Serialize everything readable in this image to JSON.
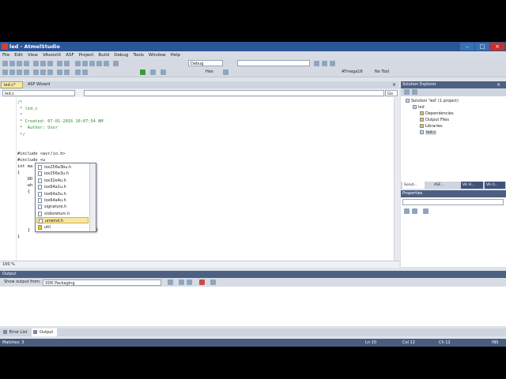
{
  "window": {
    "title": "led - AtmelStudio"
  },
  "menu": [
    "File",
    "Edit",
    "View",
    "VAssistX",
    "ASF",
    "Project",
    "Build",
    "Debug",
    "Tools",
    "Window",
    "Help"
  ],
  "toolbar": {
    "config_value": "Debug",
    "hex_label": "Hex",
    "device_label": "ATmega16",
    "tool_label": "No Tool"
  },
  "tabs": [
    {
      "label": "led.c*"
    },
    {
      "label": "ASF Wizard"
    }
  ],
  "navbar": {
    "file": "led.c",
    "go_label": "Go"
  },
  "code": [
    {
      "text": "/*",
      "kind": "comment"
    },
    {
      "text": " * led.c",
      "kind": "comment"
    },
    {
      "text": " *",
      "kind": "comment"
    },
    {
      "text": " * Created: 07-01-2016 10:07:54 AM",
      "kind": "comment"
    },
    {
      "text": " *  Author: User",
      "kind": "comment"
    },
    {
      "text": " */",
      "kind": "comment"
    },
    {
      "text": "",
      "kind": "plain"
    },
    {
      "text": "",
      "kind": "plain"
    },
    {
      "text": "#include <avr/io.h>",
      "kind": "plain"
    },
    {
      "text": "#include <u",
      "kind": "plain"
    },
    {
      "text": "int ma",
      "kind": "plain"
    },
    {
      "text": "{",
      "kind": "plain"
    },
    {
      "text": "    DD",
      "kind": "plain"
    },
    {
      "text": "    wh",
      "kind": "plain"
    },
    {
      "text": "    {",
      "kind": "plain"
    },
    {
      "text": "                  D's OFF",
      "kind": "comment"
    },
    {
      "text": "",
      "kind": "plain"
    },
    {
      "text": "",
      "kind": "plain"
    },
    {
      "text": "                  D's ON",
      "kind": "comment"
    },
    {
      "text": "",
      "kind": "plain"
    },
    {
      "text": "    }",
      "kind": "plain"
    },
    {
      "text": "}",
      "kind": "plain"
    }
  ],
  "autocomplete": {
    "items": [
      {
        "label": "iox256a3bu.h",
        "kind": "file"
      },
      {
        "label": "iox256a3u.h",
        "kind": "file"
      },
      {
        "label": "iox32e4u.h",
        "kind": "file"
      },
      {
        "label": "iox64a1u.h",
        "kind": "file"
      },
      {
        "label": "iox64a3u.h",
        "kind": "file"
      },
      {
        "label": "iox64a4u.h",
        "kind": "file"
      },
      {
        "label": "signature.h",
        "kind": "file"
      },
      {
        "label": "stdioreturn.h",
        "kind": "file"
      },
      {
        "label": "unwind.h",
        "kind": "file"
      },
      {
        "label": "util",
        "kind": "folder"
      }
    ],
    "selected_index": 8
  },
  "editor": {
    "zoom": "100 %"
  },
  "solution_explorer": {
    "title": "Solution Explorer",
    "items": [
      {
        "label": "Solution 'led' (1 project)",
        "level": 0
      },
      {
        "label": "led",
        "level": 1
      },
      {
        "label": "Dependencies",
        "level": 2
      },
      {
        "label": "Output Files",
        "level": 2
      },
      {
        "label": "Libraries",
        "level": 2
      },
      {
        "label": "led.c",
        "level": 2
      }
    ]
  },
  "panel_tabs": [
    {
      "label": "Soluti..."
    },
    {
      "label": "ASF..."
    },
    {
      "label": "VA Vi..."
    },
    {
      "label": "VA O..."
    }
  ],
  "properties": {
    "title": "Properties"
  },
  "output": {
    "title": "Output",
    "show_label": "Show output from:",
    "source": "XDK Packaging"
  },
  "bottom_tabs": [
    {
      "label": "Error List"
    },
    {
      "label": "Output"
    }
  ],
  "status": {
    "message": "Matches: 3",
    "line": "Ln 10",
    "col": "Col 12",
    "ch": "Ch 12",
    "mode": "INS"
  }
}
